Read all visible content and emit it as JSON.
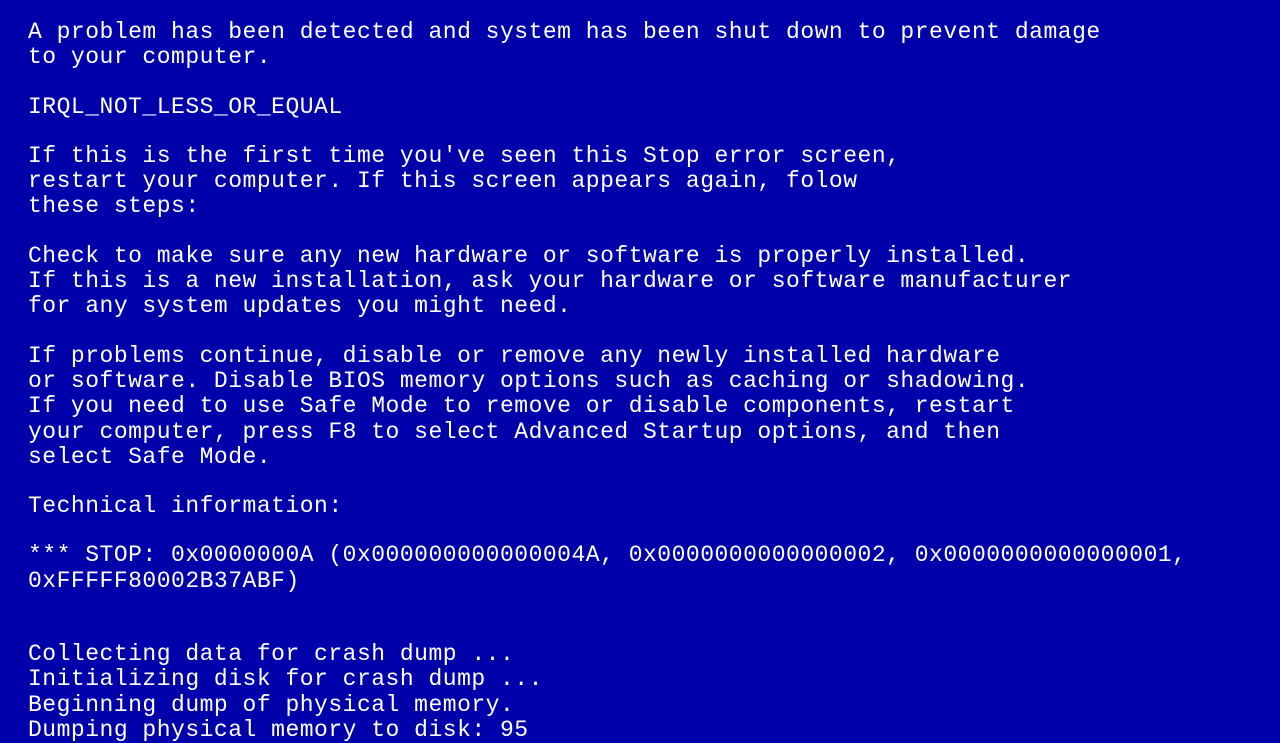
{
  "bsod": {
    "intro_l1": "A problem has been detected and system has been shut down to prevent damage",
    "intro_l2": "to your computer.",
    "error_name": "IRQL_NOT_LESS_OR_EQUAL",
    "first_time_l1": "If this is the first time you've seen this Stop error screen,",
    "first_time_l2": "restart your computer. If this screen appears again, folow",
    "first_time_l3": "these steps:",
    "check_l1": "Check to make sure any new hardware or software is properly installed.",
    "check_l2": "If this is a new installation, ask your hardware or software manufacturer",
    "check_l3": "for any system updates you might need.",
    "problems_l1": "If problems continue, disable or remove any newly installed hardware",
    "problems_l2": "or software. Disable BIOS memory options such as caching or shadowing.",
    "problems_l3": "If you need to use Safe Mode to remove or disable components, restart",
    "problems_l4": "your computer, press F8 to select Advanced Startup options, and then",
    "problems_l5": "select Safe Mode.",
    "tech_label": "Technical information:",
    "stop_l1": "*** STOP: 0x0000000A (0x000000000000004A, 0x0000000000000002, 0x0000000000000001,",
    "stop_l2": "0xFFFFF80002B37ABF)",
    "dump_l1": "Collecting data for crash dump ...",
    "dump_l2": "Initializing disk for crash dump ...",
    "dump_l3": "Beginning dump of physical memory.",
    "dump_l4": "Dumping physical memory to disk: 95"
  }
}
